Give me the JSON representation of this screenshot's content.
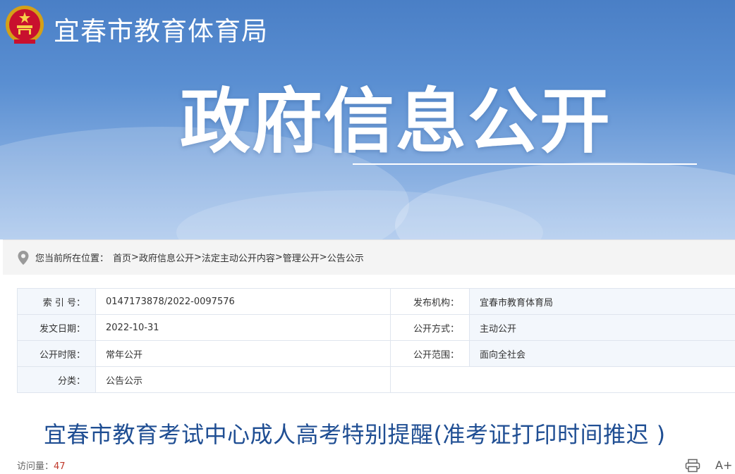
{
  "header": {
    "site_name": "宜春市教育体育局",
    "banner_title": "政府信息公开"
  },
  "breadcrumb": {
    "prefix": "您当前所在位置：",
    "items": [
      "首页",
      "政府信息公开",
      "法定主动公开内容",
      "管理公开",
      "公告公示"
    ],
    "separator": ">"
  },
  "meta": {
    "index_label": "索 引 号：",
    "index_value": "0147173878/2022-0097576",
    "publisher_label": "发布机构：",
    "publisher_value": "宜春市教育体育局",
    "date_label": "发文日期：",
    "date_value": "2022-10-31",
    "method_label": "公开方式：",
    "method_value": "主动公开",
    "period_label": "公开时限：",
    "period_value": "常年公开",
    "scope_label": "公开范围：",
    "scope_value": "面向全社会",
    "category_label": "分类：",
    "category_value": "公告公示"
  },
  "article": {
    "title": "宜春市教育考试中心成人高考特别提醒(准考证打印时间推迟 )",
    "views_label": "访问量：",
    "views_value": "47"
  },
  "tools": {
    "font_label": "A+"
  },
  "colors": {
    "banner_top": "#4a7fc6",
    "title_blue": "#1f4e93",
    "count_red": "#c0392b"
  },
  "icons": [
    "national-emblem-icon",
    "location-pin-icon",
    "print-icon",
    "font-size-icon"
  ]
}
